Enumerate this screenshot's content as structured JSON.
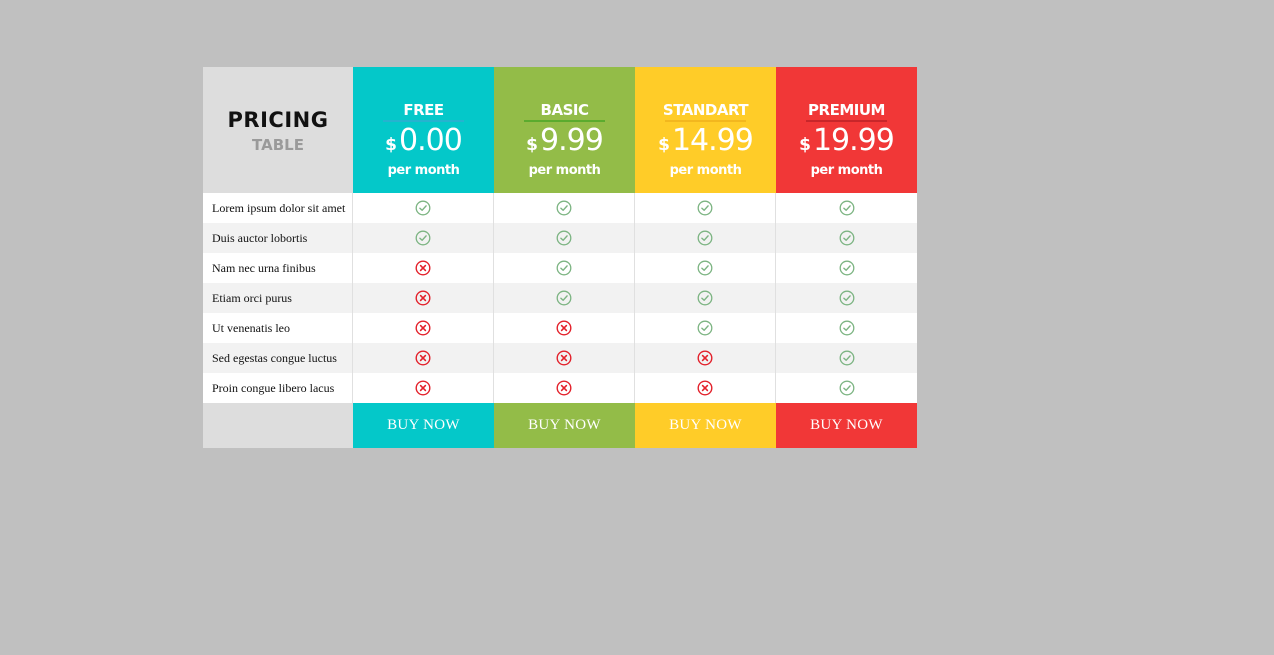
{
  "title": {
    "main": "PRICING",
    "sub": "TABLE"
  },
  "plans": [
    {
      "name": "FREE",
      "currency": "$",
      "price": "0.00",
      "period": "per month",
      "color": "#04c8c9",
      "rule": "#25b3cf",
      "button": "BUY NOW"
    },
    {
      "name": "BASIC",
      "currency": "$",
      "price": "9.99",
      "period": "per month",
      "color": "#93bc48",
      "rule": "#5bab2e",
      "button": "BUY NOW"
    },
    {
      "name": "STANDART",
      "currency": "$",
      "price": "14.99",
      "period": "per month",
      "color": "#ffcc28",
      "rule": "#f3b71e",
      "button": "BUY NOW"
    },
    {
      "name": "PREMIUM",
      "currency": "$",
      "price": "19.99",
      "period": "per month",
      "color": "#f13737",
      "rule": "#c8262a",
      "button": "BUY NOW"
    }
  ],
  "features": [
    {
      "label": "Lorem ipsum dolor sit amet",
      "included": [
        true,
        true,
        true,
        true
      ]
    },
    {
      "label": "Duis auctor lobortis",
      "included": [
        true,
        true,
        true,
        true
      ]
    },
    {
      "label": "Nam nec urna finibus",
      "included": [
        false,
        true,
        true,
        true
      ]
    },
    {
      "label": "Etiam orci purus",
      "included": [
        false,
        true,
        true,
        true
      ]
    },
    {
      "label": "Ut venenatis leo",
      "included": [
        false,
        false,
        true,
        true
      ]
    },
    {
      "label": "Sed egestas congue luctus",
      "included": [
        false,
        false,
        false,
        true
      ]
    },
    {
      "label": "Proin congue libero lacus",
      "included": [
        false,
        false,
        false,
        true
      ]
    }
  ],
  "icons": {
    "included": "check-circle-icon",
    "excluded": "x-circle-icon"
  },
  "colors": {
    "check": "#7cb482",
    "cross": "#e3212b"
  }
}
